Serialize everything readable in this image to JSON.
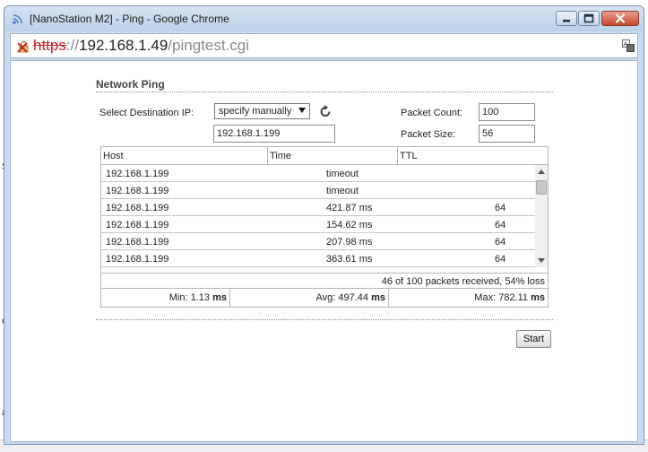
{
  "window": {
    "title": "[NanoStation M2] - Ping - Google Chrome"
  },
  "address": {
    "scheme": "https",
    "separator": "://",
    "host": "192.168.1.49",
    "path": "/pingtest.cgi"
  },
  "background": {
    "fragment_1": "S",
    "fragment_2": "e",
    "fragment_3": "ar"
  },
  "form": {
    "section_title": "Network Ping",
    "destination_label": "Select Destination IP:",
    "destination_selected": "specify manually",
    "destination_ip": "192.168.1.199",
    "packet_count_label": "Packet Count:",
    "packet_count_value": "100",
    "packet_size_label": "Packet Size:",
    "packet_size_value": "56"
  },
  "results": {
    "columns": [
      "Host",
      "Time",
      "TTL"
    ],
    "rows": [
      {
        "host": "192.168.1.199",
        "time": "timeout",
        "ttl": ""
      },
      {
        "host": "192.168.1.199",
        "time": "timeout",
        "ttl": ""
      },
      {
        "host": "192.168.1.199",
        "time": "421.87 ms",
        "ttl": "64"
      },
      {
        "host": "192.168.1.199",
        "time": "154.62 ms",
        "ttl": "64"
      },
      {
        "host": "192.168.1.199",
        "time": "207.98 ms",
        "ttl": "64"
      },
      {
        "host": "192.168.1.199",
        "time": "363.61 ms",
        "ttl": "64"
      }
    ],
    "summary": "46 of 100 packets received, 54% loss",
    "min_label": "Min:",
    "min_value": "1.13",
    "avg_label": "Avg:",
    "avg_value": "497.44",
    "max_label": "Max:",
    "max_value": "782.11",
    "unit": "ms"
  },
  "actions": {
    "start_label": "Start"
  },
  "icons": {
    "app": "wifi-signal-icon",
    "lock": "broken-lock-icon",
    "refresh": "refresh-icon",
    "translate": "translate-icon"
  },
  "colors": {
    "titlebar": "#c9dbee",
    "insecure_scheme": "#c0282a",
    "close_button": "#c9462d"
  }
}
